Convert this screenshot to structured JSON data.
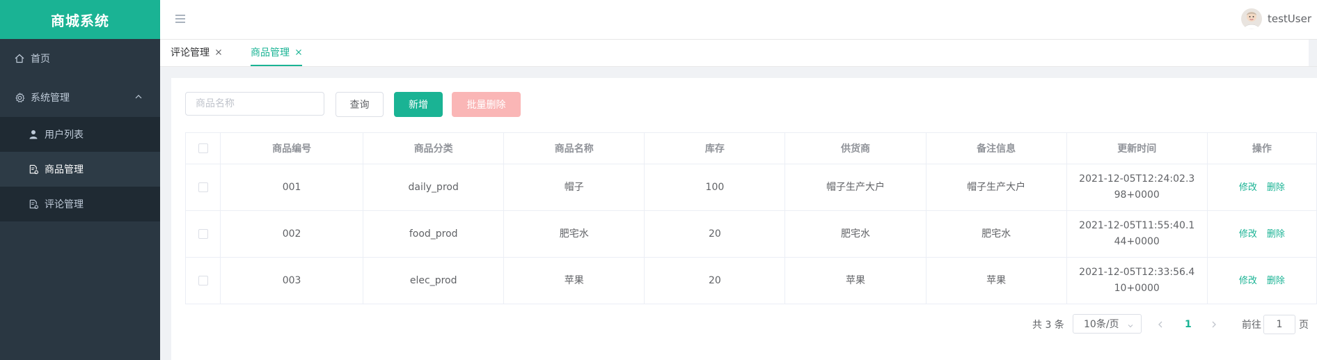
{
  "app": {
    "title": "商城系统"
  },
  "sidebar": {
    "items": [
      {
        "label": "首页",
        "icon": "home-icon"
      },
      {
        "label": "系统管理",
        "icon": "gear-icon",
        "expanded": true,
        "children": [
          {
            "label": "用户列表",
            "icon": "user-icon",
            "active": false
          },
          {
            "label": "商品管理",
            "icon": "document-icon",
            "active": true
          },
          {
            "label": "评论管理",
            "icon": "document-icon",
            "active": false
          }
        ]
      }
    ]
  },
  "header": {
    "username": "testUser"
  },
  "tabs": [
    {
      "label": "评论管理",
      "active": false
    },
    {
      "label": "商品管理",
      "active": true
    }
  ],
  "toolbar": {
    "search_placeholder": "商品名称",
    "search_value": "",
    "query_label": "查询",
    "add_label": "新增",
    "batch_delete_label": "批量删除"
  },
  "table": {
    "columns": [
      "商品编号",
      "商品分类",
      "商品名称",
      "库存",
      "供货商",
      "备注信息",
      "更新时间",
      "操作"
    ],
    "rows": [
      {
        "id": "001",
        "category": "daily_prod",
        "name": "帽子",
        "stock": "100",
        "supplier": "帽子生产大户",
        "remark": "帽子生产大户",
        "updated": "2021-12-05T12:24:02.398+0000"
      },
      {
        "id": "002",
        "category": "food_prod",
        "name": "肥宅水",
        "stock": "20",
        "supplier": "肥宅水",
        "remark": "肥宅水",
        "updated": "2021-12-05T11:55:40.144+0000"
      },
      {
        "id": "003",
        "category": "elec_prod",
        "name": "苹果",
        "stock": "20",
        "supplier": "苹果",
        "remark": "苹果",
        "updated": "2021-12-05T12:33:56.410+0000"
      }
    ],
    "edit_label": "修改",
    "delete_label": "删除"
  },
  "pagination": {
    "total_text": "共 3 条",
    "page_size_text": "10条/页",
    "current_page": "1",
    "goto_prefix": "前往",
    "goto_value": "1",
    "goto_suffix": "页"
  },
  "colors": {
    "accent": "#1ab394",
    "sidebar_bg": "#2a3742",
    "danger_disabled": "#fab6b6"
  }
}
